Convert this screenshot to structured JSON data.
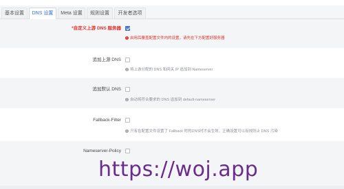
{
  "tabs": [
    {
      "label": "基本设置",
      "active": false
    },
    {
      "label": "DNS 设置",
      "active": true
    },
    {
      "label": "Meta 设置",
      "active": false
    },
    {
      "label": "规则设置",
      "active": false
    },
    {
      "label": "开发者选项",
      "active": false
    }
  ],
  "settings": [
    {
      "label": "*自定义上游 DNS 服务器",
      "required": true,
      "checked": true,
      "hint": "启用后覆盖配置文件内的设置，请先在下方配置好服务器",
      "hint_style": "warning"
    },
    {
      "label": "追加上游 DNS",
      "required": false,
      "checked": false,
      "hint": "将上游分配的 DNS 和网关 IP 追加到 Nameserver",
      "hint_style": "info"
    },
    {
      "label": "追加默认 DNS",
      "required": false,
      "checked": false,
      "hint": "自动将符合要求的 DNS 追加到 default-nameserver",
      "hint_style": "info"
    },
    {
      "label": "Fallback-Filter",
      "required": false,
      "checked": false,
      "hint": "只有在配置文件设置了 Fallback 时的DNS时才会生效，正确设置可以有效防止 DNS 污染",
      "hint_style": "info"
    },
    {
      "label": "Nameserver-Policy",
      "required": false,
      "checked": false,
      "hint": "",
      "hint_style": "info"
    }
  ],
  "icons": {
    "hint": "info-icon"
  },
  "colors": {
    "accent": "#4a7ed9",
    "warning": "#e0302a",
    "watermark": "#6a2c8c"
  },
  "watermark": "https://woj.app"
}
